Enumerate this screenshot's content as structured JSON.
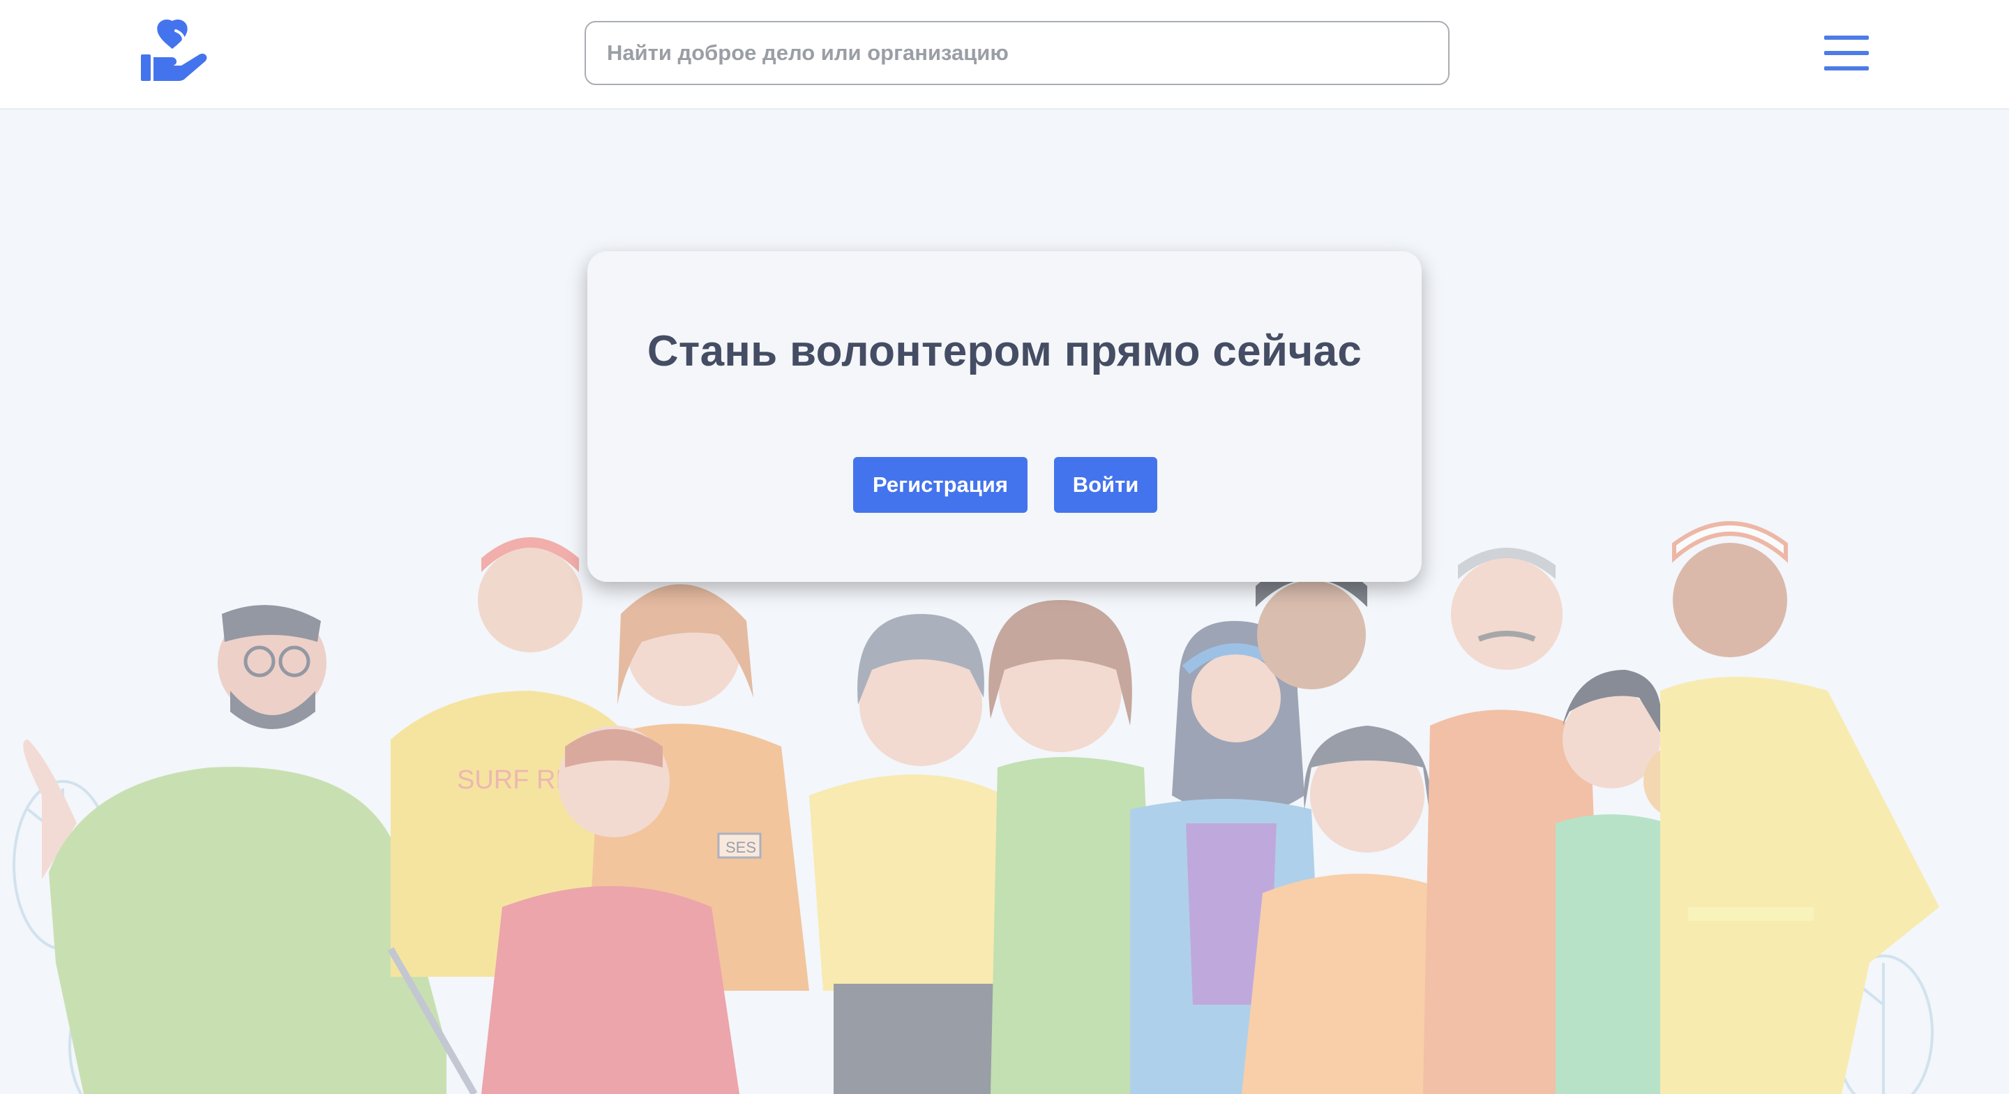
{
  "header": {
    "logo_icon": "heart-in-hand-icon",
    "search_placeholder": "Найти доброе дело или организацию",
    "search_value": "",
    "menu_icon": "hamburger-menu-icon",
    "accent_color": "#4474ed"
  },
  "hero": {
    "illustration": "crowd-of-volunteers-illustration",
    "card": {
      "title": "Стань волонтером прямо сейчас",
      "register_label": "Регистрация",
      "login_label": "Войти"
    },
    "badges": {
      "surf_rescue": "SURF RESC",
      "ses": "SES"
    }
  }
}
